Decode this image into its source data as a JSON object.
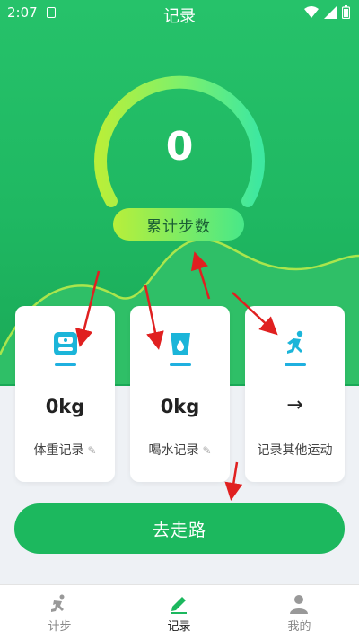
{
  "status": {
    "time": "2:07"
  },
  "header": {
    "title": "记录"
  },
  "summary": {
    "steps_value": "0",
    "steps_label": "累计步数"
  },
  "cards": [
    {
      "value": "0kg",
      "label": "体重记录"
    },
    {
      "value": "0kg",
      "label": "喝水记录"
    },
    {
      "arrow": "→",
      "label": "记录其他运动"
    }
  ],
  "primary_action": {
    "label": "去走路"
  },
  "tabs": [
    {
      "label": "计步",
      "icon": "runner-icon"
    },
    {
      "label": "记录",
      "icon": "pencil-icon",
      "active": true
    },
    {
      "label": "我的",
      "icon": "person-icon"
    }
  ],
  "colors": {
    "brand_green": "#1cb85e",
    "accent_blue": "#1fb0e0",
    "annotation_red": "#e02020"
  }
}
